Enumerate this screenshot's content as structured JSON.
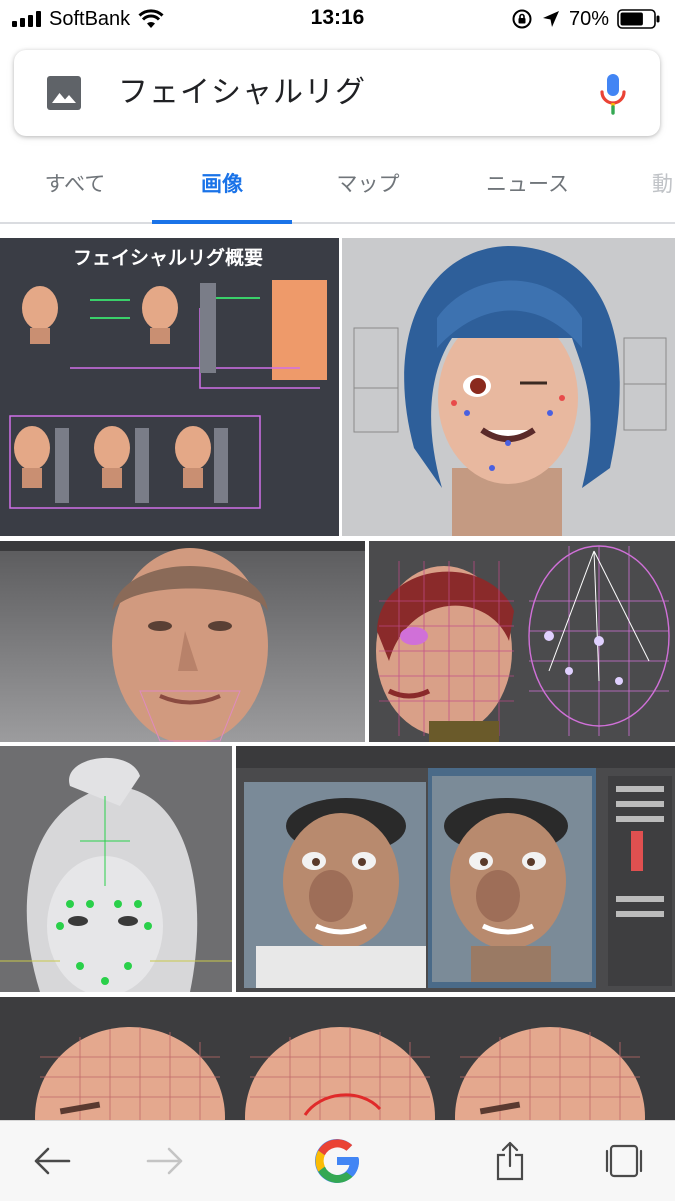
{
  "status_bar": {
    "carrier": "SoftBank",
    "time": "13:16",
    "battery_percent": "70%",
    "battery_level": 0.7
  },
  "search": {
    "query": "フェイシャルリグ"
  },
  "tabs": [
    {
      "label": "すべて",
      "active": false
    },
    {
      "label": "画像",
      "active": true
    },
    {
      "label": "マップ",
      "active": false
    },
    {
      "label": "ニュース",
      "active": false
    },
    {
      "label": "動",
      "active": false
    }
  ],
  "results": {
    "first_image_caption": "フェイシャルリグ概要"
  },
  "colors": {
    "accent": "#1a73e8",
    "tab_text": "#70757a",
    "google_blue": "#4285F4",
    "google_red": "#EA4335",
    "google_yellow": "#FBBC05",
    "google_green": "#34A853"
  },
  "icons": {
    "image_search": "image-icon",
    "voice_search": "mic-icon",
    "back": "back-arrow-icon",
    "forward": "forward-arrow-icon",
    "home": "google-g-icon",
    "share": "share-icon",
    "tabs": "tabs-icon"
  }
}
